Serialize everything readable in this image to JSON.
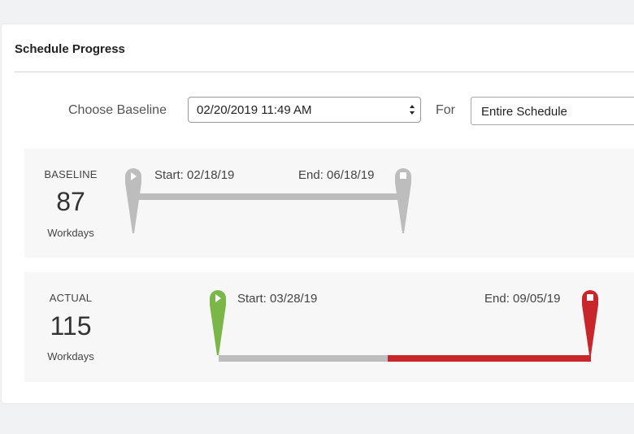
{
  "header": {
    "title": "Schedule Progress"
  },
  "filters": {
    "baseline_label": "Choose Baseline",
    "baseline_value": "02/20/2019 11:49 AM",
    "for_label": "For",
    "scope_value": "Entire Schedule"
  },
  "baseline": {
    "caption": "BASELINE",
    "workdays": "87",
    "unit": "Workdays",
    "start_text": "Start: 02/18/19",
    "end_text": "End: 06/18/19"
  },
  "actual": {
    "caption": "ACTUAL",
    "workdays": "115",
    "unit": "Workdays",
    "start_text": "Start: 03/28/19",
    "end_text": "End: 09/05/19"
  },
  "colors": {
    "start_marker_actual": "#7ab648",
    "end_marker_actual": "#c8262a",
    "baseline_marker": "#bdbdbd",
    "bar_gray": "#bdbdbd",
    "bar_overrun": "#c8262a"
  }
}
